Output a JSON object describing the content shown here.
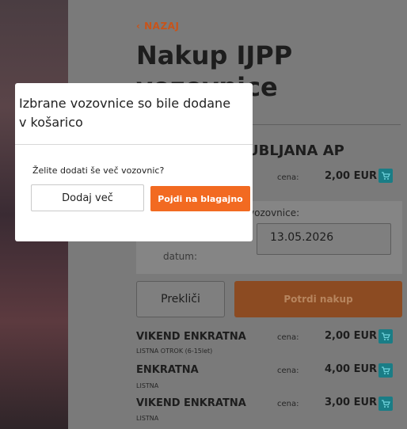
{
  "header": {
    "back_label": "‹ NAZAJ",
    "title": "Nakup IJPP vozovnice"
  },
  "route": {
    "label": "UBLJANA AP",
    "price_label": "cena:",
    "price_value": "2,00 EUR"
  },
  "form": {
    "tickets_label": "vozovnice:",
    "date_label": "datum:",
    "date_value": "13.05.2026"
  },
  "actions": {
    "cancel_label": "Prekliči",
    "confirm_label": "Potrdi nakup"
  },
  "tickets": [
    {
      "name": "VIKEND ENKRATNA",
      "sub": "LISTNA OTROK (6-15let)",
      "price_label": "cena:",
      "price": "2,00 EUR"
    },
    {
      "name": "ENKRATNA",
      "sub": "LISTNA",
      "price_label": "cena:",
      "price": "4,00 EUR"
    },
    {
      "name": "VIKEND ENKRATNA",
      "sub": "LISTNA",
      "price_label": "cena:",
      "price": "3,00 EUR"
    }
  ],
  "modal": {
    "title": "Izbrane vozovnice so bile dodane v košarico",
    "question": "Želite dodati še več vozovnic?",
    "more_label": "Dodaj več",
    "checkout_label": "Pojdi na blagajno"
  },
  "icons": {
    "cart": "cart-icon"
  },
  "colors": {
    "accent": "#f26a21",
    "cart_button": "#1a7d86"
  }
}
